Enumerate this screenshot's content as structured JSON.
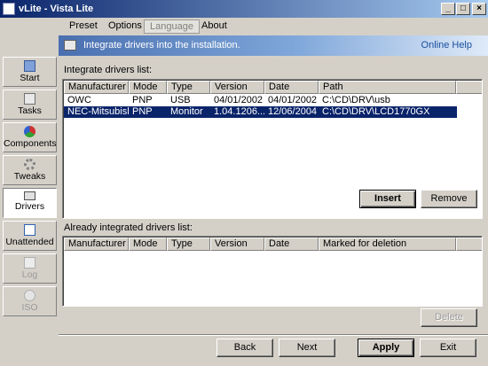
{
  "window": {
    "title": "vLite - Vista Lite",
    "minimize": "_",
    "maximize": "□",
    "close": "×"
  },
  "menu": [
    "Preset",
    "Options",
    "Language",
    "About"
  ],
  "sidebar": [
    {
      "label": "Start",
      "icon": "start-icon"
    },
    {
      "label": "Tasks",
      "icon": "tasks-icon"
    },
    {
      "label": "Components",
      "icon": "components-icon"
    },
    {
      "label": "Tweaks",
      "icon": "tweaks-icon"
    },
    {
      "label": "Drivers",
      "icon": "drivers-icon"
    },
    {
      "label": "Unattended",
      "icon": "unattended-icon"
    },
    {
      "label": "Log",
      "icon": "log-icon"
    },
    {
      "label": "ISO",
      "icon": "iso-icon"
    }
  ],
  "banner": {
    "text": "Integrate drivers into the installation.",
    "help": "Online Help"
  },
  "integrate": {
    "caption": "Integrate drivers list:",
    "columns": [
      "Manufacturer",
      "Mode",
      "Type",
      "Version",
      "Date",
      "Path"
    ],
    "rows": [
      [
        "OWC",
        "PNP",
        "USB",
        "04/01/2002",
        "04/01/2002",
        "C:\\CD\\DRV\\usb"
      ],
      [
        "NEC-Mitsubishi",
        "PNP",
        "Monitor",
        "1.04.1206...",
        "12/06/2004",
        "C:\\CD\\DRV\\LCD1770GX"
      ]
    ],
    "insert": "Insert",
    "remove": "Remove"
  },
  "integrated": {
    "caption": "Already integrated drivers list:",
    "columns": [
      "Manufacturer",
      "Mode",
      "Type",
      "Version",
      "Date",
      "Marked for deletion"
    ],
    "delete": "Delete"
  },
  "footer": {
    "back": "Back",
    "next": "Next",
    "apply": "Apply",
    "exit": "Exit"
  }
}
